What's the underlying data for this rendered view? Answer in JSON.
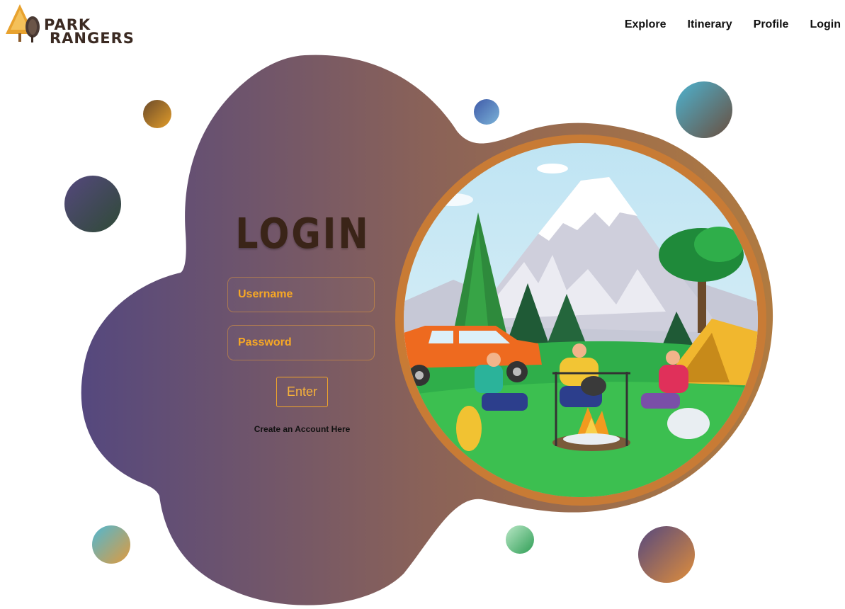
{
  "brand": {
    "line1": "PARK",
    "line2": "RANGERS"
  },
  "nav": {
    "items": [
      {
        "label": "Explore"
      },
      {
        "label": "Itinerary"
      },
      {
        "label": "Profile"
      },
      {
        "label": "Login"
      }
    ]
  },
  "login": {
    "title": "LOGIN",
    "username_placeholder": "Username",
    "password_placeholder": "Password",
    "enter_label": "Enter",
    "create_account": "Create an Account Here"
  },
  "colors": {
    "accent": "#f7a825",
    "blob_left": "#55487e",
    "blob_right": "#a06d4b",
    "ring": "#c87b35"
  },
  "illustration": "camping-scene-illustration"
}
